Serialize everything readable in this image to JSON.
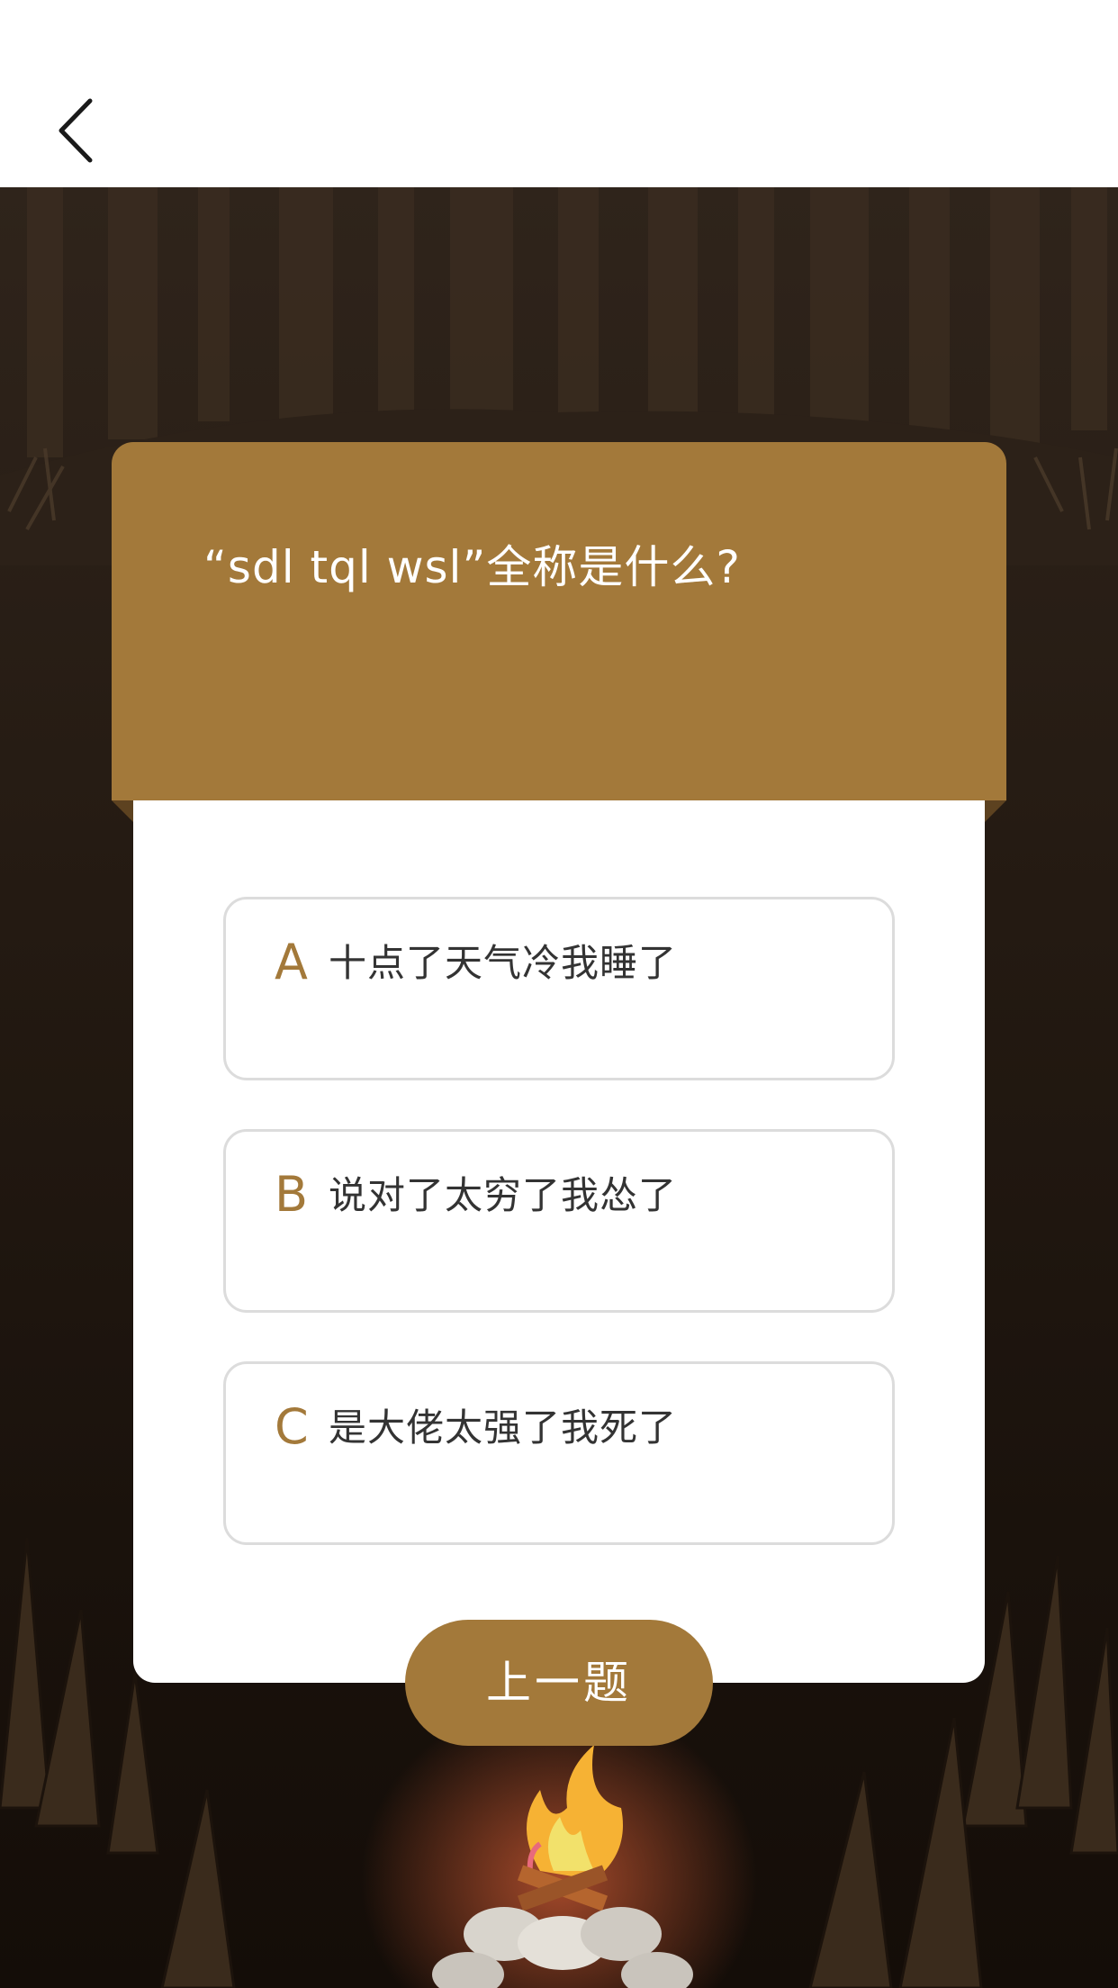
{
  "header": {
    "back_icon": "chevron-left-icon"
  },
  "quiz": {
    "question": "“sdl tql wsl”全称是什么?",
    "options": [
      {
        "letter": "A",
        "text": "十点了天气冷我睡了"
      },
      {
        "letter": "B",
        "text": "说对了太穷了我怂了"
      },
      {
        "letter": "C",
        "text": "是大佬太强了我死了"
      }
    ],
    "prev_button": "上一题"
  },
  "colors": {
    "accent": "#a3793a",
    "background": "#241a12",
    "option_text": "#333333",
    "option_border": "#dcdcdc"
  },
  "scene": {
    "decor": [
      "forest-silhouette",
      "grass",
      "campfire-icon"
    ]
  }
}
